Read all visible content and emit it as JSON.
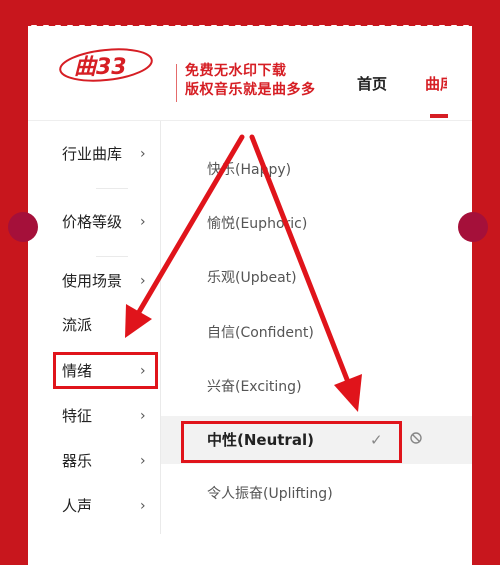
{
  "header": {
    "logo_text": "曲33",
    "slogan_line1": "免费无水印下载",
    "slogan_line2": "版权音乐就是曲多多",
    "nav": [
      {
        "label": "首页",
        "active": false
      },
      {
        "label": "曲库",
        "active": true
      }
    ]
  },
  "categories": [
    {
      "label": "行业曲库",
      "arrow": "›"
    },
    {
      "label": "价格等级",
      "arrow": "›"
    },
    {
      "label": "使用场景",
      "arrow": "›"
    },
    {
      "label": "流派",
      "arrow": ""
    },
    {
      "label": "情绪",
      "arrow": "›"
    },
    {
      "label": "特征",
      "arrow": "›"
    },
    {
      "label": "器乐",
      "arrow": "›"
    },
    {
      "label": "人声",
      "arrow": "›"
    }
  ],
  "options": [
    {
      "label": "快乐(Happy)"
    },
    {
      "label": "愉悦(Euphoric)"
    },
    {
      "label": "乐观(Upbeat)"
    },
    {
      "label": "自信(Confident)"
    },
    {
      "label": "兴奋(Exciting)"
    },
    {
      "label": "中性(Neutral)",
      "selected": true
    },
    {
      "label": "令人振奋(Uplifting)"
    }
  ],
  "icons": {
    "check": "✓",
    "ban": "ban-icon"
  },
  "colors": {
    "brand_red": "#d61e24",
    "background_red": "#c8161d",
    "annotation_red": "#e0141b"
  }
}
